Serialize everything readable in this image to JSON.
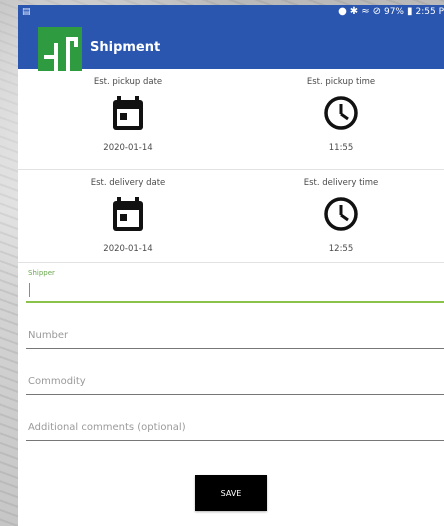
{
  "status_bar": {
    "left_icon": "notification-icon",
    "right_text": "97%",
    "time": "2:55 P",
    "icons": [
      "location-icon",
      "bluetooth-icon",
      "wifi-icon",
      "do-not-disturb-icon",
      "battery-icon"
    ]
  },
  "appbar": {
    "title": "Shipment",
    "logo_color": "#2e9b41",
    "bar_color": "#2a56b0"
  },
  "pickup": {
    "date_label": "Est. pickup date",
    "date_value": "2020-01-14",
    "time_label": "Est. pickup time",
    "time_value": "11:55"
  },
  "delivery": {
    "date_label": "Est. delivery date",
    "date_value": "2020-01-14",
    "time_label": "Est. delivery time",
    "time_value": "12:55"
  },
  "form": {
    "shipper_label": "Shipper",
    "shipper_value": "",
    "number_placeholder": "Number",
    "commodity_placeholder": "Commodity",
    "comments_placeholder": "Additional comments (optional)",
    "accent_color": "#8bc34a"
  },
  "actions": {
    "save_label": "SAVE"
  }
}
